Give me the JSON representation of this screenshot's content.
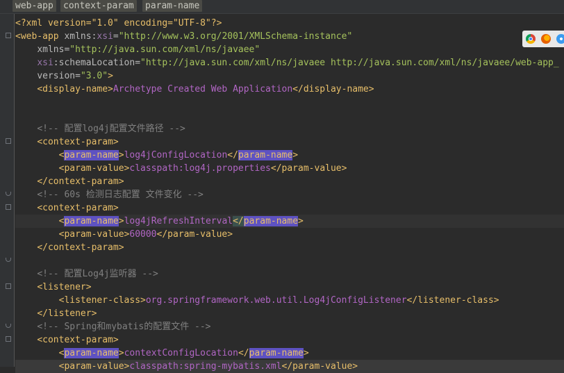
{
  "breadcrumbs": [
    "web-app",
    "context-param",
    "param-name"
  ],
  "lines": {
    "l1": "<?xml version=\"1.0\" encoding=\"UTF-8\"?>",
    "l2_tag": "<web-app ",
    "l2_attr": "xmlns:",
    "l2_ns": "xsi",
    "l2_eq": "=",
    "l2_val": "\"http://www.w3.org/2001/XMLSchema-instance\"",
    "l3_attr": "xmlns=",
    "l3_val": "\"http://java.sun.com/xml/ns/javaee\"",
    "l4_ns": "xsi",
    "l4_attr": ":schemaLocation=",
    "l4_val": "\"http://java.sun.com/xml/ns/javaee http://java.sun.com/xml/ns/javaee/web-app_",
    "l5_attr": "version=",
    "l5_val": "\"3.0\"",
    "l5_close": ">",
    "l6_open": "<display-name>",
    "l6_val": "Archetype Created Web Application",
    "l6_close": "</display-name>",
    "l9": "<!-- 配置log4j配置文件路径 -->",
    "l10": "<context-param>",
    "l11_open_a": "<",
    "l11_name": "param-name",
    "l11_open_b": ">",
    "l11_val": "log4jConfigLocation",
    "l11_close_a": "</",
    "l11_close_name": "param-name",
    "l11_close_b": ">",
    "l12_open": "<param-value>",
    "l12_val": "classpath:log4j.properties",
    "l12_close": "</param-value>",
    "l13": "</context-param>",
    "l14": "<!-- 60s 检测日志配置 文件变化 -->",
    "l15": "<context-param>",
    "l16_open_a": "<",
    "l16_name": "param-name",
    "l16_open_b": ">",
    "l16_val": "log4jRefreshInterval",
    "l16_close_a": "</",
    "l16_close_name": "param-name",
    "l16_close_b": ">",
    "l17_open": "<param-value>",
    "l17_val": "60000",
    "l17_close": "</param-value>",
    "l18": "</context-param>",
    "l20": "<!-- 配置Log4j监听器 -->",
    "l21": "<listener>",
    "l22_open": "<listener-class>",
    "l22_val": "org.springframework.web.util.Log4jConfigListener",
    "l22_close": "</listener-class>",
    "l23": "</listener>",
    "l24": "<!-- Spring和mybatis的配置文件 -->",
    "l25": "<context-param>",
    "l26_open_a": "<",
    "l26_name": "param-name",
    "l26_open_b": ">",
    "l26_val": "contextConfigLocation",
    "l26_close_a": "</",
    "l26_close_name": "param-name",
    "l26_close_b": ">",
    "l27_open": "<param-value>",
    "l27_val": "classpath:spring-mybatis.xml",
    "l27_close": "</param-value>"
  },
  "browser_icons": [
    "chrome-icon",
    "firefox-icon",
    "safari-icon"
  ],
  "colors": {
    "background": "#2b2b2b",
    "tag": "#e8bf6a",
    "string": "#a5c25c",
    "value": "#b166c4",
    "comment": "#808080",
    "highlight": "#5e52c2"
  }
}
